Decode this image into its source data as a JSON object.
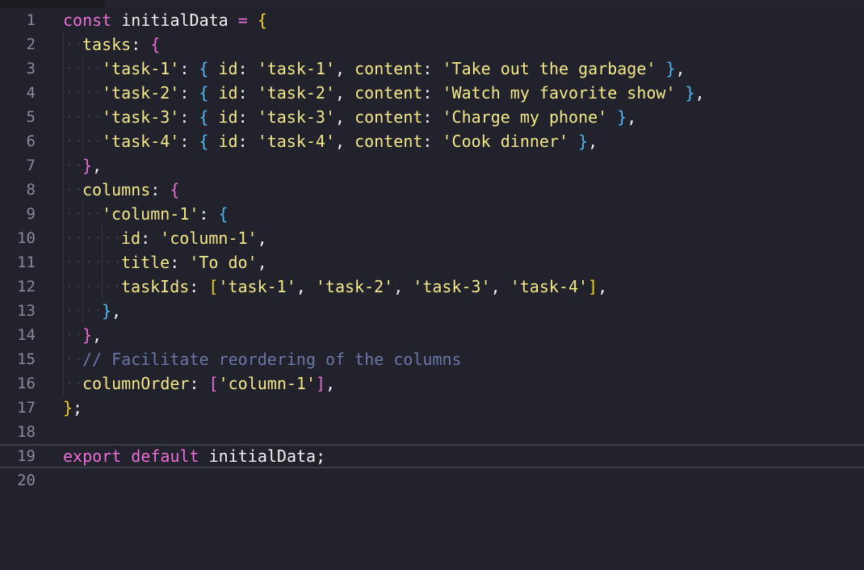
{
  "editor": {
    "language": "javascript",
    "active_line": 19,
    "colors": {
      "background": "#22222c",
      "keyword": "#e96fd6",
      "string": "#f4e98a",
      "comment": "#6a77a8",
      "bracket_level_1": "#f2d027",
      "bracket_level_2": "#e96fd6",
      "bracket_level_3": "#4fb6f0",
      "line_number": "#8a8a96"
    },
    "lines": [
      {
        "n": "1",
        "indent": 0,
        "tokens": [
          [
            "kw",
            "const"
          ],
          [
            "plain",
            " initialData "
          ],
          [
            "op",
            "="
          ],
          [
            "plain",
            " "
          ],
          [
            "b1",
            "{"
          ]
        ]
      },
      {
        "n": "2",
        "indent": 1,
        "tokens": [
          [
            "prop",
            "tasks"
          ],
          [
            "punc",
            ": "
          ],
          [
            "b2",
            "{"
          ]
        ]
      },
      {
        "n": "3",
        "indent": 2,
        "tokens": [
          [
            "str",
            "'task-1'"
          ],
          [
            "punc",
            ": "
          ],
          [
            "b3",
            "{"
          ],
          [
            "prop",
            " id"
          ],
          [
            "punc",
            ": "
          ],
          [
            "str",
            "'task-1'"
          ],
          [
            "punc",
            ", "
          ],
          [
            "prop",
            "content"
          ],
          [
            "punc",
            ": "
          ],
          [
            "str",
            "'Take out the garbage'"
          ],
          [
            "punc",
            " "
          ],
          [
            "b3",
            "}"
          ],
          [
            "punc",
            ","
          ]
        ]
      },
      {
        "n": "4",
        "indent": 2,
        "tokens": [
          [
            "str",
            "'task-2'"
          ],
          [
            "punc",
            ": "
          ],
          [
            "b3",
            "{"
          ],
          [
            "prop",
            " id"
          ],
          [
            "punc",
            ": "
          ],
          [
            "str",
            "'task-2'"
          ],
          [
            "punc",
            ", "
          ],
          [
            "prop",
            "content"
          ],
          [
            "punc",
            ": "
          ],
          [
            "str",
            "'Watch my favorite show'"
          ],
          [
            "punc",
            " "
          ],
          [
            "b3",
            "}"
          ],
          [
            "punc",
            ","
          ]
        ]
      },
      {
        "n": "5",
        "indent": 2,
        "tokens": [
          [
            "str",
            "'task-3'"
          ],
          [
            "punc",
            ": "
          ],
          [
            "b3",
            "{"
          ],
          [
            "prop",
            " id"
          ],
          [
            "punc",
            ": "
          ],
          [
            "str",
            "'task-3'"
          ],
          [
            "punc",
            ", "
          ],
          [
            "prop",
            "content"
          ],
          [
            "punc",
            ": "
          ],
          [
            "str",
            "'Charge my phone'"
          ],
          [
            "punc",
            " "
          ],
          [
            "b3",
            "}"
          ],
          [
            "punc",
            ","
          ]
        ]
      },
      {
        "n": "6",
        "indent": 2,
        "tokens": [
          [
            "str",
            "'task-4'"
          ],
          [
            "punc",
            ": "
          ],
          [
            "b3",
            "{"
          ],
          [
            "prop",
            " id"
          ],
          [
            "punc",
            ": "
          ],
          [
            "str",
            "'task-4'"
          ],
          [
            "punc",
            ", "
          ],
          [
            "prop",
            "content"
          ],
          [
            "punc",
            ": "
          ],
          [
            "str",
            "'Cook dinner'"
          ],
          [
            "punc",
            " "
          ],
          [
            "b3",
            "}"
          ],
          [
            "punc",
            ","
          ]
        ]
      },
      {
        "n": "7",
        "indent": 1,
        "tokens": [
          [
            "b2",
            "}"
          ],
          [
            "punc",
            ","
          ]
        ]
      },
      {
        "n": "8",
        "indent": 1,
        "tokens": [
          [
            "prop",
            "columns"
          ],
          [
            "punc",
            ": "
          ],
          [
            "b2",
            "{"
          ]
        ]
      },
      {
        "n": "9",
        "indent": 2,
        "tokens": [
          [
            "str",
            "'column-1'"
          ],
          [
            "punc",
            ": "
          ],
          [
            "b3",
            "{"
          ]
        ]
      },
      {
        "n": "10",
        "indent": 3,
        "tokens": [
          [
            "prop",
            "id"
          ],
          [
            "punc",
            ": "
          ],
          [
            "str",
            "'column-1'"
          ],
          [
            "punc",
            ","
          ]
        ]
      },
      {
        "n": "11",
        "indent": 3,
        "tokens": [
          [
            "prop",
            "title"
          ],
          [
            "punc",
            ": "
          ],
          [
            "str",
            "'To do'"
          ],
          [
            "punc",
            ","
          ]
        ]
      },
      {
        "n": "12",
        "indent": 3,
        "tokens": [
          [
            "prop",
            "taskIds"
          ],
          [
            "punc",
            ": "
          ],
          [
            "b1",
            "["
          ],
          [
            "str",
            "'task-1'"
          ],
          [
            "punc",
            ", "
          ],
          [
            "str",
            "'task-2'"
          ],
          [
            "punc",
            ", "
          ],
          [
            "str",
            "'task-3'"
          ],
          [
            "punc",
            ", "
          ],
          [
            "str",
            "'task-4'"
          ],
          [
            "b1",
            "]"
          ],
          [
            "punc",
            ","
          ]
        ]
      },
      {
        "n": "13",
        "indent": 2,
        "tokens": [
          [
            "b3",
            "}"
          ],
          [
            "punc",
            ","
          ]
        ]
      },
      {
        "n": "14",
        "indent": 1,
        "tokens": [
          [
            "b2",
            "}"
          ],
          [
            "punc",
            ","
          ]
        ]
      },
      {
        "n": "15",
        "indent": 1,
        "tokens": [
          [
            "cm",
            "// Facilitate reordering of the columns"
          ]
        ]
      },
      {
        "n": "16",
        "indent": 1,
        "tokens": [
          [
            "prop",
            "columnOrder"
          ],
          [
            "punc",
            ": "
          ],
          [
            "b2",
            "["
          ],
          [
            "str",
            "'column-1'"
          ],
          [
            "b2",
            "]"
          ],
          [
            "punc",
            ","
          ]
        ]
      },
      {
        "n": "17",
        "indent": 0,
        "tokens": [
          [
            "b1",
            "}"
          ],
          [
            "punc",
            ";"
          ]
        ]
      },
      {
        "n": "18",
        "indent": 0,
        "tokens": []
      },
      {
        "n": "19",
        "indent": 0,
        "tokens": [
          [
            "kw",
            "export"
          ],
          [
            "plain",
            " "
          ],
          [
            "kw",
            "default"
          ],
          [
            "plain",
            " initialData;"
          ]
        ]
      },
      {
        "n": "20",
        "indent": 0,
        "tokens": []
      }
    ]
  }
}
